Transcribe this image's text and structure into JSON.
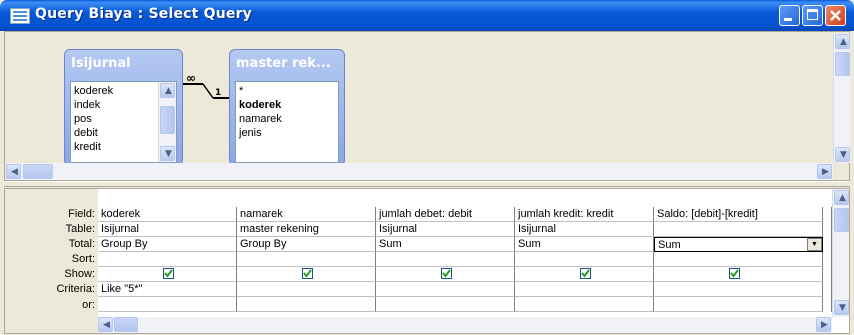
{
  "window": {
    "title": "Query Biaya : Select Query",
    "icon": "query-design-icon",
    "buttons": [
      "minimize-icon",
      "maximize-icon",
      "close-icon"
    ]
  },
  "tables": [
    {
      "name": "Isijurnal",
      "fields": [
        "koderek",
        "indek",
        "pos",
        "debit",
        "kredit"
      ]
    },
    {
      "name": "master rek...",
      "fields": [
        "*",
        "koderek",
        "namarek",
        "jenis"
      ]
    }
  ],
  "relationship": {
    "one_side": "1",
    "many_side": "∞",
    "key_field": "koderek"
  },
  "grid": {
    "row_labels": [
      "Field:",
      "Table:",
      "Total:",
      "Sort:",
      "Show:",
      "Criteria:",
      "or:"
    ],
    "columns": [
      {
        "field": "koderek",
        "table": "Isijurnal",
        "total": "Group By",
        "sort": "",
        "show": true,
        "criteria": "Like \"5*\"",
        "or": ""
      },
      {
        "field": "namarek",
        "table": "master rekening",
        "total": "Group By",
        "sort": "",
        "show": true,
        "criteria": "",
        "or": ""
      },
      {
        "field": "jumlah debet: debit",
        "table": "Isijurnal",
        "total": "Sum",
        "sort": "",
        "show": true,
        "criteria": "",
        "or": ""
      },
      {
        "field": "jumlah kredit: kredit",
        "table": "Isijurnal",
        "total": "Sum",
        "sort": "",
        "show": true,
        "criteria": "",
        "or": ""
      },
      {
        "field": "Saldo: [debit]-[kredit]",
        "table": "",
        "total": "Sum",
        "sort": "",
        "show": true,
        "criteria": "",
        "or": ""
      }
    ]
  },
  "colors": {
    "titlebar": "#0858d8",
    "table_header": "#9ab4ec",
    "dialog": "#ece9d8"
  }
}
